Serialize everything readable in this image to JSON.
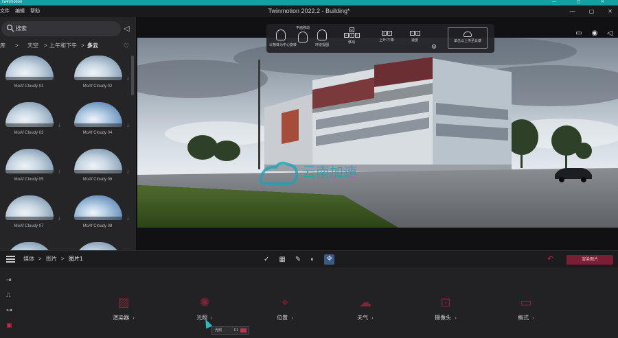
{
  "window": {
    "app_name": "Twinmotion",
    "title": "Twinmotion 2022.2 - Building*",
    "controls": [
      "—",
      "▢",
      "✕"
    ]
  },
  "menu": [
    "文件",
    "编辑",
    "帮助"
  ],
  "library": {
    "search_placeholder": "搜索",
    "breadcrumb": [
      "库",
      ">",
      "天空",
      ">",
      "上午和下午",
      ">",
      "多云"
    ],
    "items": [
      {
        "label": "MoAf Cloudy 01",
        "variant": "white"
      },
      {
        "label": "MoAf Cloudy 02",
        "variant": "white"
      },
      {
        "label": "MoAf Cloudy 03",
        "variant": "white"
      },
      {
        "label": "MoAf Cloudy 04",
        "variant": "blue"
      },
      {
        "label": "MoAf Cloudy 05",
        "variant": "white"
      },
      {
        "label": "MoAf Cloudy 06",
        "variant": "white"
      },
      {
        "label": "MoAf Cloudy 07",
        "variant": "white"
      },
      {
        "label": "MoAf Cloudy 08",
        "variant": "blue"
      }
    ]
  },
  "viewport_toolbar": {
    "items": [
      {
        "label": "以物体为中心旋转"
      },
      {
        "label": "平面移动",
        "key": "0"
      },
      {
        "label": "环绕视图"
      },
      {
        "label": "移动",
        "keys": [
          "W",
          "A",
          "S",
          "D"
        ]
      },
      {
        "label": "上升/下降",
        "keys": [
          "Q",
          "E"
        ]
      },
      {
        "label": "速度",
        "keys": [
          "1",
          "6"
        ]
      }
    ],
    "upload_label": "单击以上传至云端"
  },
  "bottom": {
    "breadcrumb": [
      "媒体",
      ">",
      "图片",
      ">",
      "图片1"
    ],
    "render_button": "渲染图片"
  },
  "dock": {
    "categories": [
      {
        "label": "渲染器",
        "icon": "renderer-icon"
      },
      {
        "label": "光照",
        "icon": "lighting-icon"
      },
      {
        "label": "位置",
        "icon": "location-icon"
      },
      {
        "label": "天气",
        "icon": "weather-icon"
      },
      {
        "label": "摄像头",
        "icon": "camera-icon"
      },
      {
        "label": "格式",
        "icon": "format-icon"
      }
    ],
    "tooltip": {
      "label": "光照",
      "key": "F1"
    }
  },
  "watermark": "云南加速",
  "colors": {
    "accent": "#c2334f",
    "teal": "#12a0a2",
    "active_tool": "#3a5a86"
  }
}
